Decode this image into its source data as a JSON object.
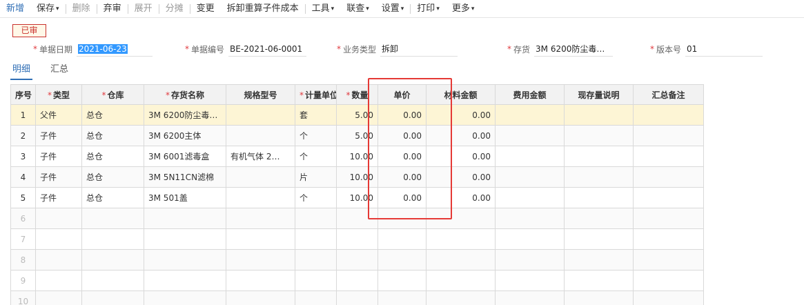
{
  "toolbar": {
    "items": [
      {
        "label": "新增",
        "caret": false
      },
      {
        "label": "保存",
        "caret": true
      },
      {
        "label": "删除",
        "caret": false
      },
      {
        "label": "弃审",
        "caret": false
      },
      {
        "label": "展开",
        "caret": false
      },
      {
        "label": "分摊",
        "caret": false
      },
      {
        "label": "变更",
        "caret": false
      },
      {
        "label": "拆卸重算子件成本",
        "caret": false
      },
      {
        "label": "工具",
        "caret": true
      },
      {
        "label": "联查",
        "caret": true
      },
      {
        "label": "设置",
        "caret": true
      },
      {
        "label": "打印",
        "caret": true
      },
      {
        "label": "更多",
        "caret": true
      }
    ]
  },
  "status": {
    "badge": "已审"
  },
  "header": {
    "date": {
      "label": "单据日期",
      "value": "2021-06-23"
    },
    "code": {
      "label": "单据编号",
      "value": "BE-2021-06-0001"
    },
    "biz_type": {
      "label": "业务类型",
      "value": "拆卸"
    },
    "inventory": {
      "label": "存货",
      "value": "3M 6200防尘毒…"
    },
    "version": {
      "label": "版本号",
      "value": "01"
    }
  },
  "tabs": [
    {
      "label": "明细",
      "active": true
    },
    {
      "label": "汇总",
      "active": false
    }
  ],
  "grid": {
    "columns": [
      {
        "label": "序号",
        "required": false
      },
      {
        "label": "类型",
        "required": true
      },
      {
        "label": "仓库",
        "required": true
      },
      {
        "label": "存货名称",
        "required": true
      },
      {
        "label": "规格型号",
        "required": false
      },
      {
        "label": "计量单位",
        "required": true
      },
      {
        "label": "数量",
        "required": true
      },
      {
        "label": "单价",
        "required": false
      },
      {
        "label": "材料金额",
        "required": false
      },
      {
        "label": "费用金额",
        "required": false
      },
      {
        "label": "现存量说明",
        "required": false
      },
      {
        "label": "汇总备注",
        "required": false
      }
    ],
    "rows": [
      {
        "idx": "1",
        "type": "父件",
        "warehouse": "总仓",
        "name": "3M 6200防尘毒…",
        "spec": "",
        "unit": "套",
        "qty": "5.00",
        "price": "0.00",
        "material": "0.00",
        "fee": "",
        "stock_note": "",
        "remark": ""
      },
      {
        "idx": "2",
        "type": "子件",
        "warehouse": "总仓",
        "name": "3M 6200主体",
        "spec": "",
        "unit": "个",
        "qty": "5.00",
        "price": "0.00",
        "material": "0.00",
        "fee": "",
        "stock_note": "",
        "remark": ""
      },
      {
        "idx": "3",
        "type": "子件",
        "warehouse": "总仓",
        "name": "3M 6001滤毒盒",
        "spec": "有机气体 2…",
        "unit": "个",
        "qty": "10.00",
        "price": "0.00",
        "material": "0.00",
        "fee": "",
        "stock_note": "",
        "remark": ""
      },
      {
        "idx": "4",
        "type": "子件",
        "warehouse": "总仓",
        "name": "3M 5N11CN滤棉",
        "spec": "",
        "unit": "片",
        "qty": "10.00",
        "price": "0.00",
        "material": "0.00",
        "fee": "",
        "stock_note": "",
        "remark": ""
      },
      {
        "idx": "5",
        "type": "子件",
        "warehouse": "总仓",
        "name": "3M 501盖",
        "spec": "",
        "unit": "个",
        "qty": "10.00",
        "price": "0.00",
        "material": "0.00",
        "fee": "",
        "stock_note": "",
        "remark": ""
      }
    ],
    "empty_rows": [
      "6",
      "7",
      "8",
      "9",
      "10"
    ]
  },
  "colors": {
    "accent": "#2f6eb5",
    "required": "#e0393e",
    "highlight_row": "#fdf5d5",
    "annotation": "#e53935"
  }
}
